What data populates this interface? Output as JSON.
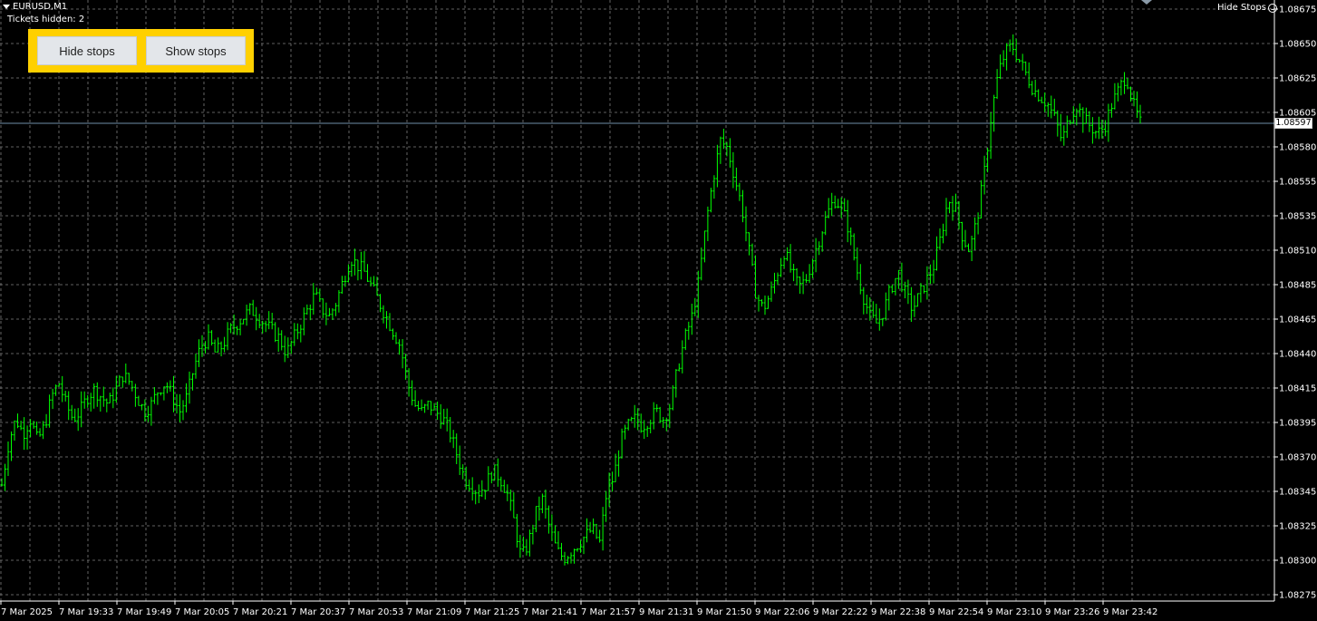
{
  "window": {
    "symbol_title": "EURUSD,M1",
    "tickets_hidden": "Tickets hidden: 2",
    "hide_stops_label": "Hide Stops"
  },
  "panel": {
    "hide_button": "Hide stops",
    "show_button": "Show stops"
  },
  "colors": {
    "background": "#000000",
    "grid": "#7f7f7f",
    "bars": "#00ff00",
    "bid_line": "#6f8ea8",
    "panel": "#ffd000"
  },
  "chart_data": {
    "type": "bar",
    "symbol": "EURUSD",
    "timeframe": "M1",
    "ylim": [
      1.08265,
      1.08685
    ],
    "current_price": "1.08597",
    "current_price_value": 1.08597,
    "price_ticks": [
      "1.08675",
      "1.08650",
      "1.08625",
      "1.08605",
      "1.08580",
      "1.08555",
      "1.08535",
      "1.08510",
      "1.08485",
      "1.08465",
      "1.08440",
      "1.08415",
      "1.08395",
      "1.08370",
      "1.08345",
      "1.08325",
      "1.08300",
      "1.08275"
    ],
    "time_ticks": [
      "7 Mar 2025",
      "7 Mar 19:33",
      "7 Mar 19:49",
      "7 Mar 20:05",
      "7 Mar 20:21",
      "7 Mar 20:37",
      "7 Mar 20:53",
      "7 Mar 21:09",
      "7 Mar 21:25",
      "7 Mar 21:41",
      "7 Mar 21:57",
      "9 Mar 21:31",
      "9 Mar 21:50",
      "9 Mar 22:06",
      "9 Mar 22:22",
      "9 Mar 22:38",
      "9 Mar 22:54",
      "9 Mar 23:10",
      "9 Mar 23:26",
      "9 Mar 23:42"
    ],
    "close_series": [
      1.0835,
      1.0838,
      1.08395,
      1.08385,
      1.08395,
      1.0838,
      1.0839,
      1.0841,
      1.0842,
      1.08405,
      1.08395,
      1.084,
      1.0841,
      1.08415,
      1.0841,
      1.08405,
      1.08415,
      1.08425,
      1.0842,
      1.0841,
      1.084,
      1.08405,
      1.08415,
      1.0842,
      1.0841,
      1.084,
      1.0841,
      1.0843,
      1.08445,
      1.0845,
      1.0844,
      1.08445,
      1.08455,
      1.0846,
      1.08465,
      1.0847,
      1.08465,
      1.0846,
      1.08455,
      1.0845,
      1.0844,
      1.0845,
      1.0846,
      1.0847,
      1.0848,
      1.0847,
      1.08465,
      1.08475,
      1.0849,
      1.08505,
      1.085,
      1.08495,
      1.08485,
      1.08475,
      1.08465,
      1.08455,
      1.08445,
      1.0842,
      1.08405,
      1.084,
      1.08405,
      1.084,
      1.08395,
      1.08385,
      1.0837,
      1.08355,
      1.0835,
      1.08345,
      1.0835,
      1.0836,
      1.08355,
      1.08345,
      1.08325,
      1.083,
      1.0831,
      1.0833,
      1.0834,
      1.0832,
      1.08305,
      1.083,
      1.08305,
      1.0831,
      1.08315,
      1.0832,
      1.0831,
      1.08345,
      1.08355,
      1.0838,
      1.0839,
      1.08395,
      1.0839,
      1.08395,
      1.084,
      1.08395,
      1.08405,
      1.0843,
      1.0845,
      1.08465,
      1.0849,
      1.0853,
      1.0856,
      1.08585,
      1.0858,
      1.0856,
      1.0854,
      1.0851,
      1.0848,
      1.0847,
      1.0848,
      1.08495,
      1.0851,
      1.08495,
      1.08485,
      1.0849,
      1.08505,
      1.0852,
      1.08535,
      1.08545,
      1.0854,
      1.08525,
      1.085,
      1.0848,
      1.08465,
      1.0846,
      1.0847,
      1.08485,
      1.08495,
      1.0848,
      1.0847,
      1.0848,
      1.0849,
      1.085,
      1.0852,
      1.08545,
      1.0854,
      1.0852,
      1.0851,
      1.0853,
      1.0856,
      1.086,
      1.0863,
      1.08645,
      1.0865,
      1.0864,
      1.0863,
      1.0862,
      1.08615,
      1.0861,
      1.086,
      1.08585,
      1.086,
      1.0861,
      1.086,
      1.08595,
      1.0859,
      1.08595,
      1.0861,
      1.0862,
      1.0863,
      1.0861,
      1.08597
    ]
  }
}
